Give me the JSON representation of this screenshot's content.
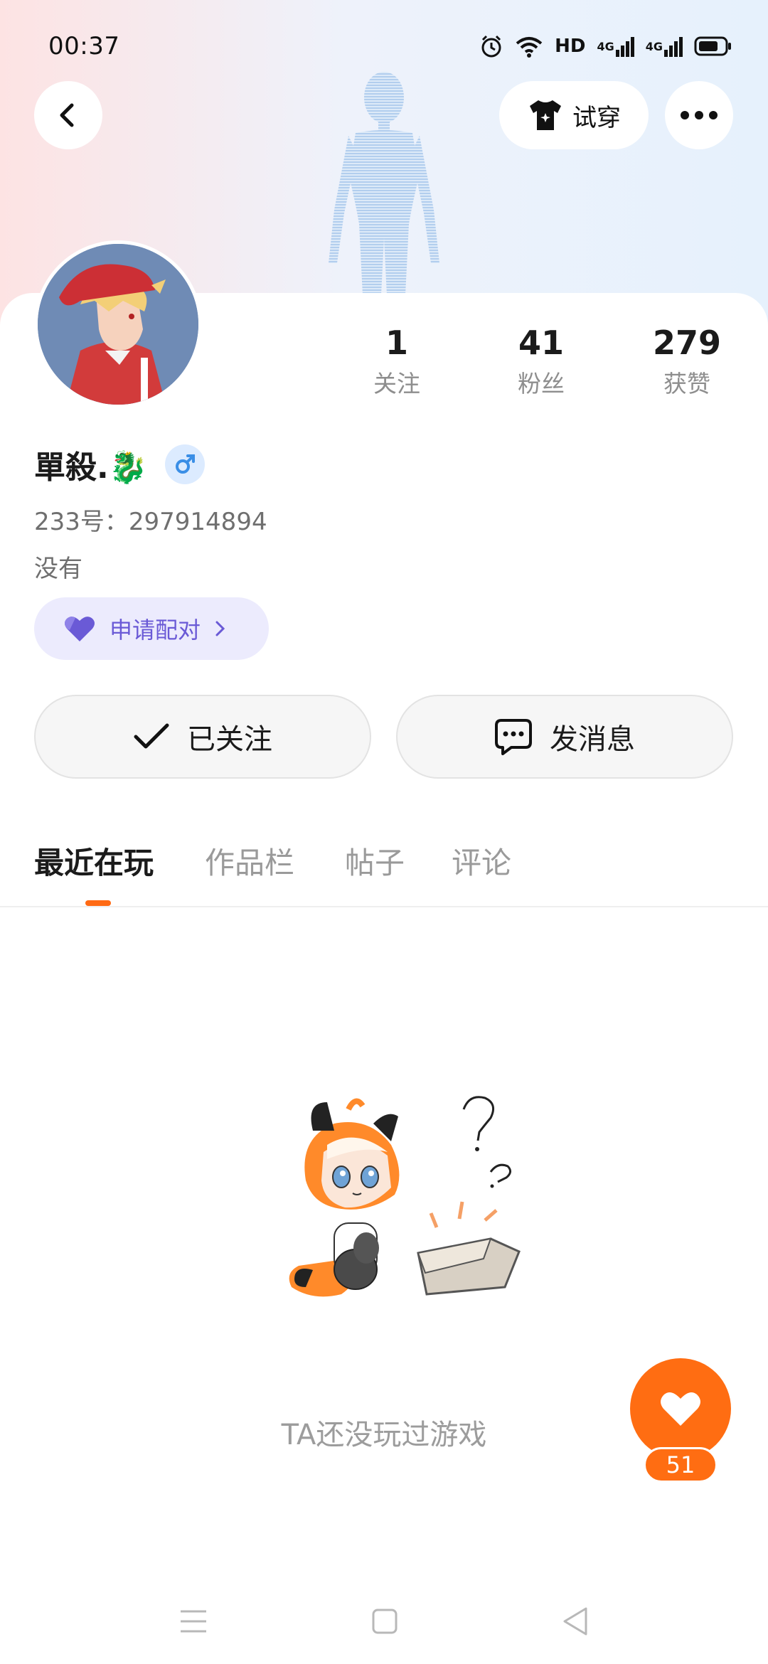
{
  "status_bar": {
    "time": "00:37",
    "hd_label": "HD",
    "net1": "4G",
    "net2": "4G"
  },
  "header": {
    "tryon_label": "试穿"
  },
  "profile": {
    "name": "單殺.🐉",
    "uid_text": "233号：297914894",
    "bio": "没有",
    "pair_label": "申请配对"
  },
  "stats": [
    {
      "value": "1",
      "label": "关注"
    },
    {
      "value": "41",
      "label": "粉丝"
    },
    {
      "value": "279",
      "label": "获赞"
    }
  ],
  "actions": {
    "followed_label": "已关注",
    "message_label": "发消息"
  },
  "tabs": [
    {
      "label": "最近在玩",
      "active": true
    },
    {
      "label": "作品栏",
      "active": false
    },
    {
      "label": "帖子",
      "active": false
    },
    {
      "label": "评论",
      "active": false
    }
  ],
  "empty_state": {
    "text": "TA还没玩过游戏"
  },
  "fab": {
    "count": "51"
  },
  "colors": {
    "accent": "#ff6d12",
    "pair_purple": "#6a5ad6",
    "gender_blue": "#3a8ee6"
  }
}
